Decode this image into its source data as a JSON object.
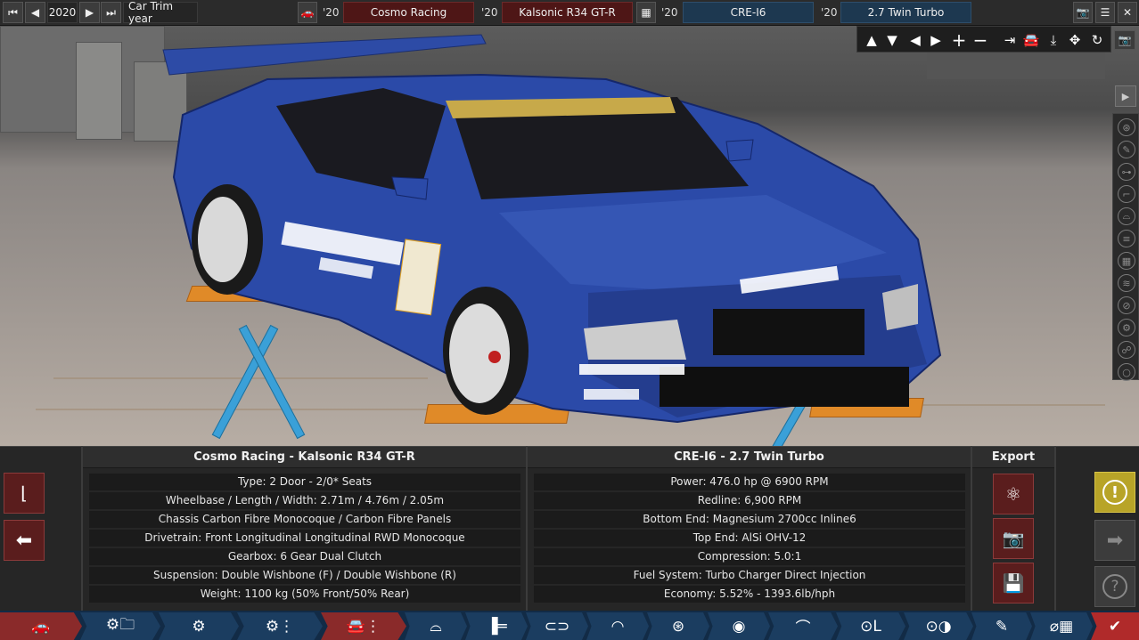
{
  "topbar": {
    "year": "2020",
    "year_mode_label": "Car Trim year",
    "model_year": "'20",
    "model_name": "Cosmo Racing",
    "trim_year": "'20",
    "trim_name": "Kalsonic R34 GT-R",
    "engine_family_year": "'20",
    "engine_family_name": "CRE-I6",
    "engine_variant_year": "'20",
    "engine_variant_name": "2.7 Twin Turbo"
  },
  "camera_toolbar": {
    "icons": [
      "arrow-up-icon",
      "arrow-down-icon",
      "arrow-left-icon",
      "arrow-right-icon",
      "zoom-in-icon",
      "zoom-out-icon",
      "snap-right-icon",
      "car-view-icon",
      "lower-icon",
      "move-icon",
      "rotate-icon"
    ]
  },
  "car_column": {
    "header": "Cosmo Racing - Kalsonic R34 GT-R",
    "rows": [
      "Type: 2 Door - 2/0* Seats",
      "Wheelbase / Length / Width: 2.71m / 4.76m / 2.05m",
      "Chassis Carbon Fibre Monocoque / Carbon Fibre Panels",
      "Drivetrain: Front Longitudinal Longitudinal RWD Monocoque",
      "Gearbox: 6 Gear Dual Clutch",
      "Suspension: Double Wishbone (F) / Double Wishbone (R)",
      "Weight: 1100 kg (50% Front/50% Rear)"
    ]
  },
  "engine_column": {
    "header": "CRE-I6 - 2.7 Twin Turbo",
    "rows": [
      "Power: 476.0 hp @ 6900 RPM",
      "Redline:  6,900 RPM",
      "Bottom End: Magnesium 2700cc Inline6",
      "Top End: AlSi OHV-12",
      "Compression: 5.0:1",
      "Fuel System: Turbo Charger Direct Injection",
      "Economy: 5.52% - 1393.6lb/hph"
    ]
  },
  "export": {
    "header": "Export"
  },
  "colors": {
    "accent_red": "#5a1d1d",
    "tab_blue": "#1b3d60",
    "active_tab": "#8a2a2a",
    "warning_gold": "#b8a428",
    "car_blue": "#2b4aa8"
  }
}
